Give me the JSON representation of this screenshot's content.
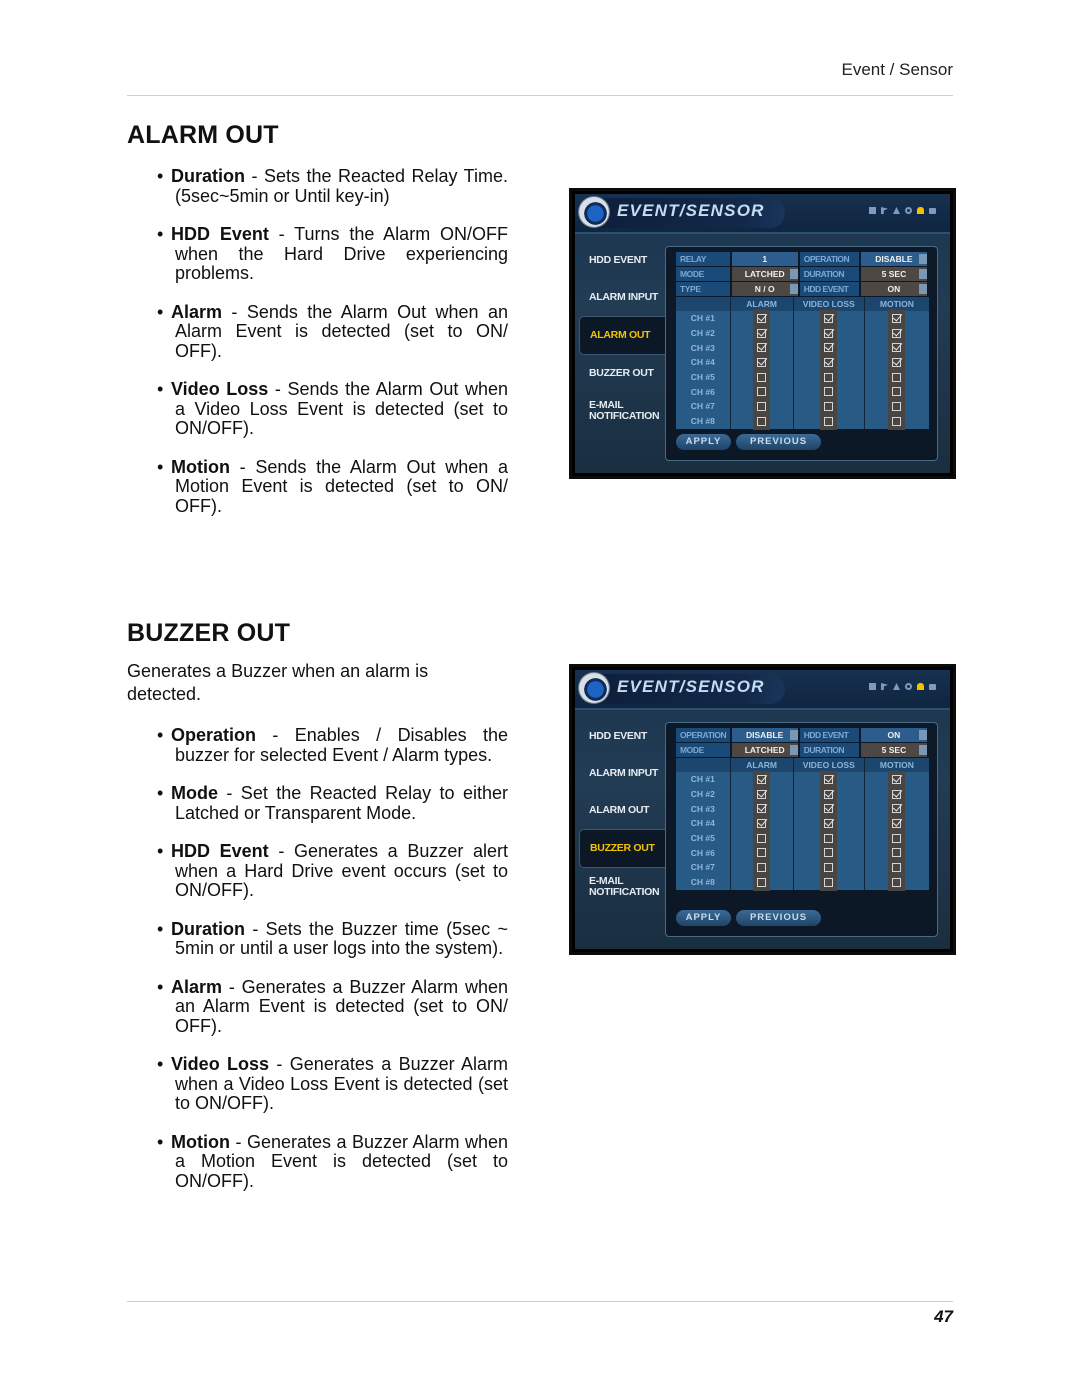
{
  "running_head": "Event / Sensor",
  "page_number": "47",
  "alarm_out": {
    "heading": "ALARM OUT",
    "bullets": [
      {
        "term": "Duration",
        "text": " - Sets the Reacted Relay Time. (5sec~5min or Until key-in)"
      },
      {
        "term": "HDD Event",
        "text": " - Turns the Alarm ON/OFF when the Hard Drive experiencing problems."
      },
      {
        "term": "Alarm",
        "text": " - Sends the Alarm Out when an Alarm Event is detected (set to ON/ OFF)."
      },
      {
        "term": "Video Loss",
        "text": " - Sends the Alarm Out when a Video Loss Event is detected (set to ON/OFF)."
      },
      {
        "term": "Motion",
        "text": " - Sends the Alarm Out when a Motion Event is detected (set to ON/ OFF)."
      }
    ],
    "screen": {
      "title": "EVENT/SENSOR",
      "tabs": [
        "HDD EVENT",
        "ALARM INPUT",
        "ALARM OUT",
        "BUZZER OUT",
        "E-MAIL NOTIFICATION"
      ],
      "active_tab": "ALARM OUT",
      "fields": [
        {
          "label": "RELAY",
          "value": "1",
          "label2": "OPERATION",
          "value2": "DISABLE"
        },
        {
          "label": "MODE",
          "value": "LATCHED",
          "label2": "DURATION",
          "value2": "5 SEC"
        },
        {
          "label": "TYPE",
          "value": "N / O",
          "label2": "HDD EVENT",
          "value2": "ON"
        }
      ],
      "columns": [
        "ALARM",
        "VIDEO LOSS",
        "MOTION"
      ],
      "channels": [
        {
          "ch": "CH #1",
          "alarm": true,
          "video_loss": true,
          "motion": true
        },
        {
          "ch": "CH #2",
          "alarm": true,
          "video_loss": true,
          "motion": true
        },
        {
          "ch": "CH #3",
          "alarm": true,
          "video_loss": true,
          "motion": true
        },
        {
          "ch": "CH #4",
          "alarm": true,
          "video_loss": true,
          "motion": true
        },
        {
          "ch": "CH #5",
          "alarm": false,
          "video_loss": false,
          "motion": false
        },
        {
          "ch": "CH #6",
          "alarm": false,
          "video_loss": false,
          "motion": false
        },
        {
          "ch": "CH #7",
          "alarm": false,
          "video_loss": false,
          "motion": false
        },
        {
          "ch": "CH #8",
          "alarm": false,
          "video_loss": false,
          "motion": false
        }
      ],
      "apply_label": "APPLY",
      "previous_label": "PREVIOUS"
    }
  },
  "buzzer_out": {
    "heading": "BUZZER OUT",
    "intro": "Generates a Buzzer when an alarm is detected.",
    "bullets": [
      {
        "term": "Operation",
        "text": " - Enables / Disables the buzzer for selected Event / Alarm types."
      },
      {
        "term": "Mode",
        "text": " - Set the Reacted Relay to either Latched or Transparent Mode."
      },
      {
        "term": "HDD Event",
        "text": " - Generates a Buzzer alert when a Hard Drive event occurs (set to ON/OFF)."
      },
      {
        "term": "Duration",
        "text": " - Sets the Buzzer time (5sec ~ 5min or until a user logs into the system)."
      },
      {
        "term": "Alarm",
        "text": " - Generates a Buzzer Alarm when an Alarm Event is detected (set to ON/ OFF)."
      },
      {
        "term": "Video Loss",
        "text": " - Generates a Buzzer Alarm when a Video Loss Event is detected (set to ON/OFF)."
      },
      {
        "term": "Motion",
        "text": " - Generates a Buzzer Alarm when a Motion Event is detected (set to ON/OFF)."
      }
    ],
    "screen": {
      "title": "EVENT/SENSOR",
      "tabs": [
        "HDD EVENT",
        "ALARM INPUT",
        "ALARM OUT",
        "BUZZER OUT",
        "E-MAIL NOTIFICATION"
      ],
      "active_tab": "BUZZER OUT",
      "fields": [
        {
          "label": "OPERATION",
          "value": "DISABLE",
          "label2": "HDD EVENT",
          "value2": "ON"
        },
        {
          "label": "MODE",
          "value": "LATCHED",
          "label2": "DURATION",
          "value2": "5 SEC"
        }
      ],
      "columns": [
        "ALARM",
        "VIDEO LOSS",
        "MOTION"
      ],
      "channels": [
        {
          "ch": "CH #1",
          "alarm": true,
          "video_loss": true,
          "motion": true
        },
        {
          "ch": "CH #2",
          "alarm": true,
          "video_loss": true,
          "motion": true
        },
        {
          "ch": "CH #3",
          "alarm": true,
          "video_loss": true,
          "motion": true
        },
        {
          "ch": "CH #4",
          "alarm": true,
          "video_loss": true,
          "motion": true
        },
        {
          "ch": "CH #5",
          "alarm": false,
          "video_loss": false,
          "motion": false
        },
        {
          "ch": "CH #6",
          "alarm": false,
          "video_loss": false,
          "motion": false
        },
        {
          "ch": "CH #7",
          "alarm": false,
          "video_loss": false,
          "motion": false
        },
        {
          "ch": "CH #8",
          "alarm": false,
          "video_loss": false,
          "motion": false
        }
      ],
      "apply_label": "APPLY",
      "previous_label": "PREVIOUS"
    }
  },
  "colors": {
    "active_tab": "#f2c200",
    "screen_bg": "#1c3550",
    "field_label_bg": "#1a4a77"
  }
}
